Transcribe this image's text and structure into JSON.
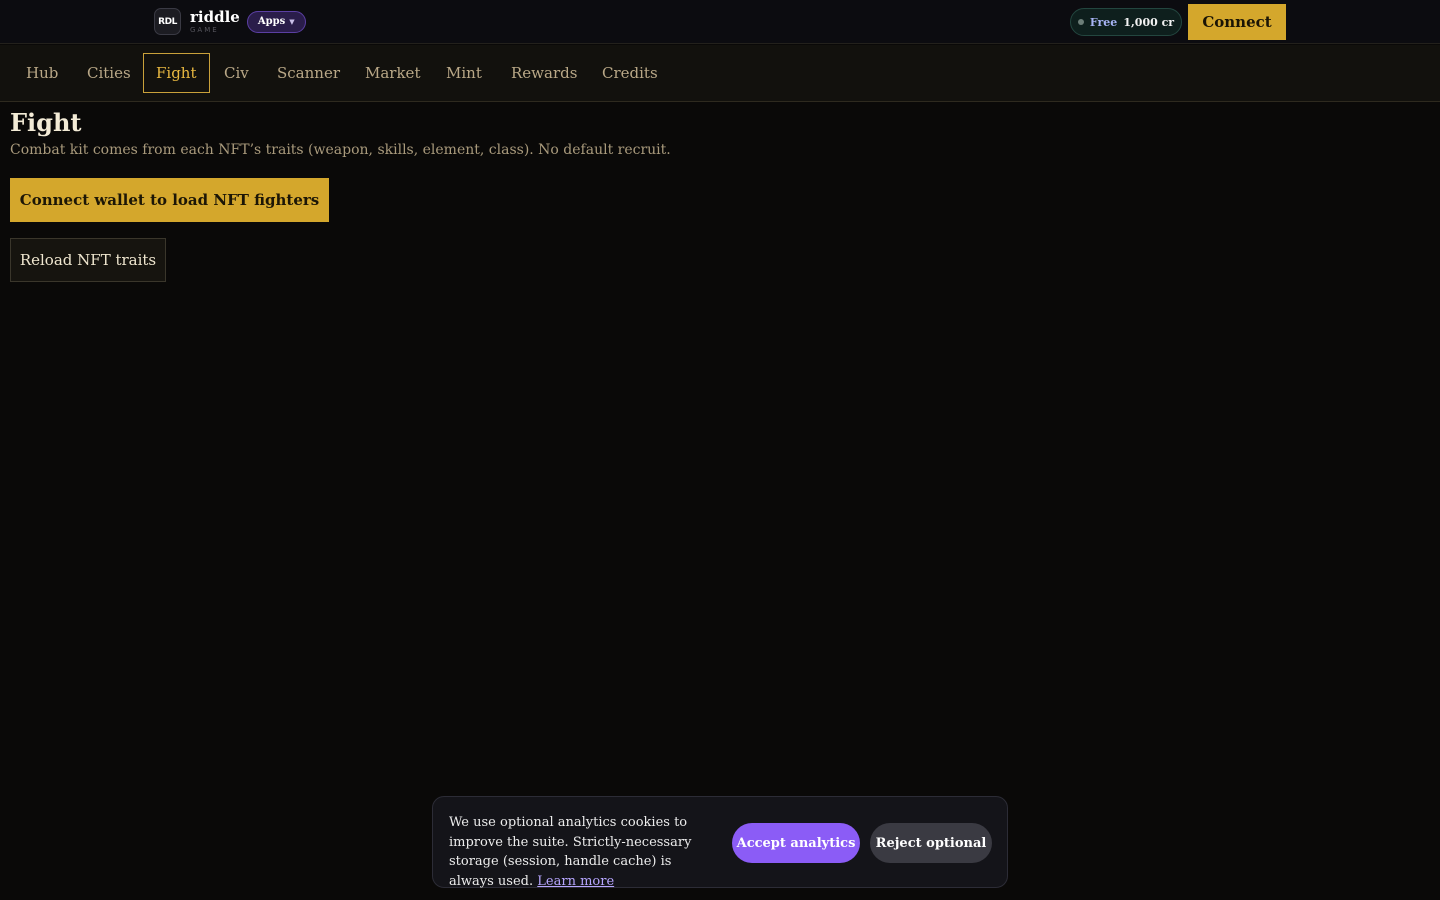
{
  "header": {
    "logo_text": "RDL",
    "brand_name": "riddle",
    "brand_sub": "GAME",
    "apps_label": "Apps",
    "credits": {
      "tier": "Free",
      "amount": "1,000 cr"
    },
    "connect_label": "Connect"
  },
  "nav": {
    "items": [
      {
        "label": "Hub"
      },
      {
        "label": "Cities"
      },
      {
        "label": "Fight"
      },
      {
        "label": "Civ"
      },
      {
        "label": "Scanner"
      },
      {
        "label": "Market"
      },
      {
        "label": "Mint"
      },
      {
        "label": "Rewards"
      },
      {
        "label": "Credits"
      }
    ],
    "active": "Fight"
  },
  "main": {
    "title": "Fight",
    "description": "Combat kit comes from each NFT’s traits (weapon, skills, element, class). No default recruit.",
    "connect_wallet_label": "Connect wallet to load NFT fighters",
    "reload_label": "Reload NFT traits"
  },
  "cookie": {
    "text": "We use optional analytics cookies to improve the suite. Strictly-necessary storage (session, handle cache) is always used.",
    "learn_more": "Learn more",
    "accept_label": "Accept analytics",
    "reject_label": "Reject optional"
  },
  "colors": {
    "accent_gold": "#d4a72c",
    "accent_purple": "#8b5cf6",
    "background": "#0a0908"
  }
}
